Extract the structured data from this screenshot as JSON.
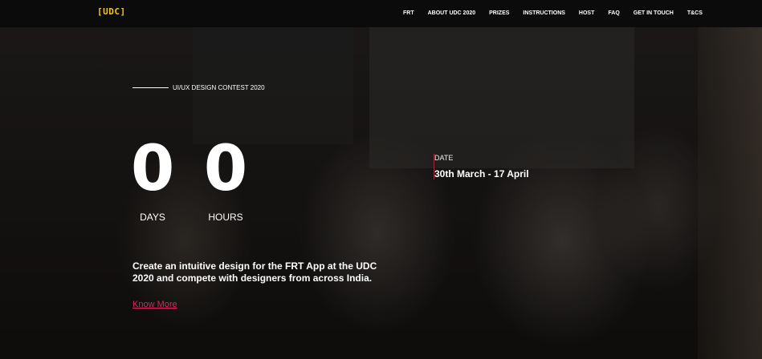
{
  "header": {
    "logo": "[UDC]",
    "nav": [
      "FRT",
      "ABOUT UDC 2020",
      "PRIZES",
      "INSTRUCTIONS",
      "HOST",
      "FAQ",
      "GET IN TOUCH",
      "T&CS"
    ]
  },
  "hero": {
    "eyebrow": "UI/UX DESIGN CONTEST 2020",
    "countdown": {
      "days": {
        "value": "0",
        "label": "DAYS"
      },
      "hours": {
        "value": "0",
        "label": "HOURS"
      }
    },
    "date": {
      "label": "DATE",
      "range": "30th March - 17 April"
    },
    "tagline": "Create an intuitive design for the FRT App at the UDC 2020 and compete with designers from across India.",
    "cta": "Know More"
  },
  "colors": {
    "logo": "#f4c518",
    "link": "#e0245e",
    "navbar": "#0b0b0b"
  }
}
